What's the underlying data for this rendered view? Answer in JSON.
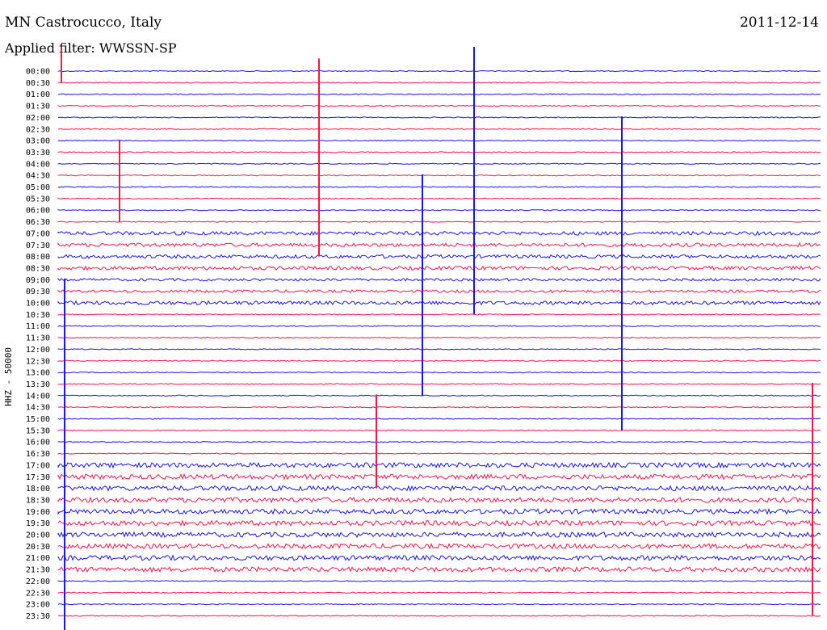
{
  "header": {
    "station": "MN Castrocucco, Italy",
    "filter": "Applied filter: WWSSN-SP",
    "date": "2011-12-14"
  },
  "y_axis_label": "HHZ - 50000",
  "colors": {
    "blue": "#1a14ff",
    "red": "#ff1444"
  },
  "time_labels": [
    "00:00",
    "00:30",
    "01:00",
    "01:30",
    "02:00",
    "02:30",
    "03:00",
    "03:30",
    "04:00",
    "04:30",
    "05:00",
    "05:30",
    "06:00",
    "06:30",
    "07:00",
    "07:30",
    "08:00",
    "08:30",
    "09:00",
    "09:30",
    "10:00",
    "10:30",
    "11:00",
    "11:30",
    "12:00",
    "12:30",
    "13:00",
    "13:30",
    "14:00",
    "14:30",
    "15:00",
    "15:30",
    "16:00",
    "16:30",
    "17:00",
    "17:30",
    "18:00",
    "18:30",
    "19:00",
    "19:30",
    "20:00",
    "20:30",
    "21:00",
    "21:30",
    "22:00",
    "22:30",
    "23:00",
    "23:30"
  ]
}
